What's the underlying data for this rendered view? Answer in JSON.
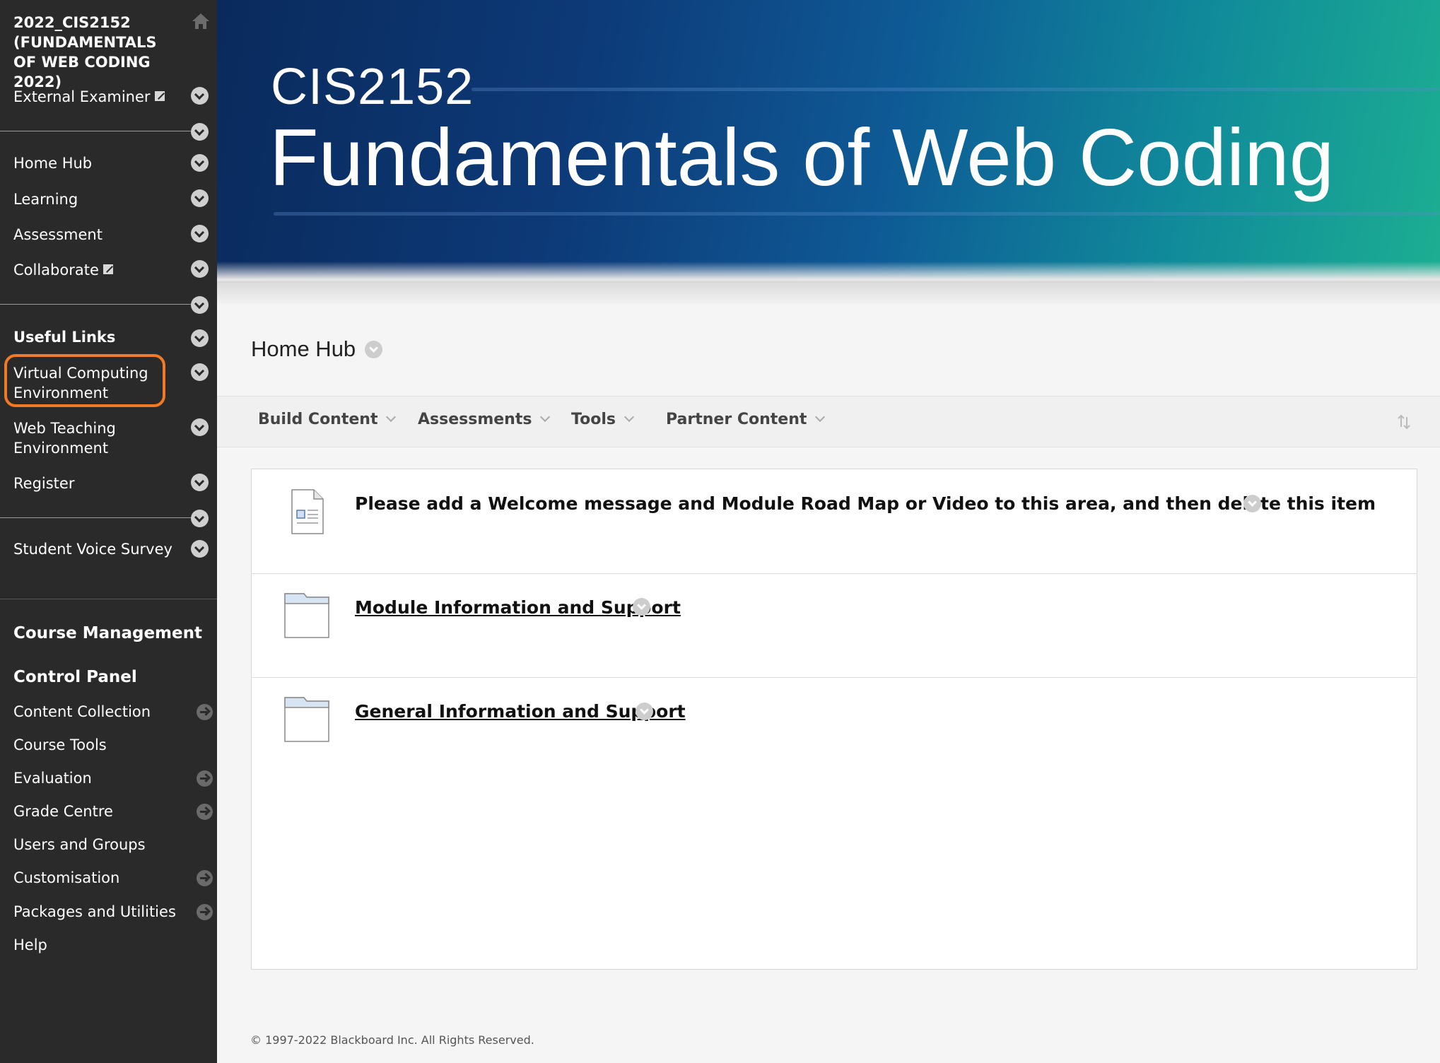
{
  "sidebar": {
    "course_title": "2022_CIS2152 (FUNDAMENTALS OF WEB CODING 2022)",
    "external_examiner": "External Examiner",
    "nav": {
      "home_hub": "Home Hub",
      "learning": "Learning",
      "assessment": "Assessment",
      "collaborate": "Collaborate"
    },
    "useful_links_heading": "Useful Links",
    "links": {
      "vce_line1": "Virtual Computing",
      "vce_line2": "Environment",
      "wte_line1": "Web Teaching",
      "wte_line2": "Environment",
      "register": "Register"
    },
    "student_voice_survey": "Student Voice Survey",
    "course_management": "Course Management",
    "control_panel": "Control Panel",
    "control_items": [
      "Content Collection",
      "Course Tools",
      "Evaluation",
      "Grade Centre",
      "Users and Groups",
      "Customisation",
      "Packages and Utilities",
      "Help"
    ]
  },
  "banner": {
    "code": "CIS2152",
    "title": "Fundamentals of Web Coding"
  },
  "main": {
    "page_title": "Home Hub",
    "toolbar": {
      "build_content": "Build Content",
      "assessments": "Assessments",
      "tools": "Tools",
      "partner_content": "Partner Content"
    },
    "items": [
      {
        "title": "Please add a Welcome message and Module Road Map or Video to this area, and then delete this item",
        "icon": "document-icon"
      },
      {
        "title": "Module Information and Support",
        "icon": "folder-icon"
      },
      {
        "title": "General Information and Support",
        "icon": "folder-icon"
      }
    ],
    "footer": "© 1997-2022 Blackboard Inc. All Rights Reserved."
  },
  "colors": {
    "sidebar_bg": "#2a2a2a",
    "highlight_ring": "#f07a26",
    "banner_start": "#0a2a5c",
    "banner_end": "#1cae92"
  }
}
